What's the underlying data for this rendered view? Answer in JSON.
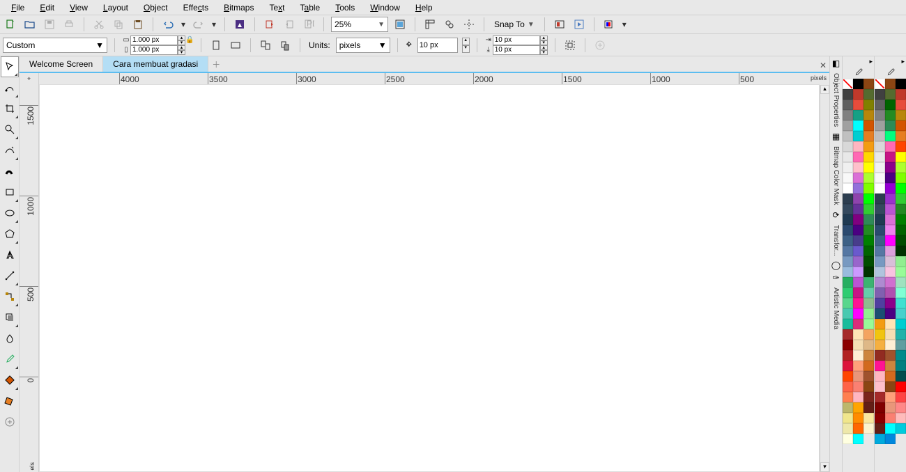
{
  "menu": [
    "File",
    "Edit",
    "View",
    "Layout",
    "Object",
    "Effects",
    "Bitmaps",
    "Text",
    "Table",
    "Tools",
    "Window",
    "Help"
  ],
  "toolbar": {
    "zoom": "25%",
    "snap": "Snap To"
  },
  "propbar": {
    "preset": "Custom",
    "width": "1.000 px",
    "height": "1.000 px",
    "units_label": "Units:",
    "units": "pixels",
    "nudge": "10 px",
    "dup_x": "10 px",
    "dup_y": "10 px"
  },
  "tabs": {
    "welcome": "Welcome Screen",
    "doc": "Cara membuat gradasi"
  },
  "ruler": {
    "hvals": [
      "4000",
      "3500",
      "3000",
      "2500",
      "2000",
      "1500",
      "1000",
      "500"
    ],
    "unit": "pixels",
    "vvals": [
      "1500",
      "1000",
      "500",
      "0"
    ],
    "unitv": "els"
  },
  "dock": {
    "titles": [
      "Object Properties",
      "Bitmap Color Mask",
      "Transfor...",
      "Artistic Media"
    ]
  },
  "palette1": [
    "nocolor",
    "#000000",
    "#8B4513",
    "#404040",
    "#C0392B",
    "#556B2F",
    "#606060",
    "#E74C3C",
    "#808000",
    "#808080",
    "#16A085",
    "#B8860B",
    "#A0A0A0",
    "#00FFFF",
    "#D35400",
    "#C0C0C0",
    "#00CED1",
    "#E67E22",
    "#D8D8D8",
    "#FFB6C1",
    "#F39C12",
    "#E8E8E8",
    "#FF69B4",
    "#FFD700",
    "#F0F0F0",
    "#FFC0CB",
    "#FFFF00",
    "#F8F8F8",
    "#DA70D6",
    "#ADFF2F",
    "#FFFFFF",
    "#9370DB",
    "#7FFF00",
    "#2C3E50",
    "#8E44AD",
    "#00FF00",
    "#34495E",
    "#663399",
    "#32CD32",
    "#1F3A52",
    "#800080",
    "#2E8B57",
    "#2B4A6F",
    "#4B0082",
    "#228B22",
    "#3D6186",
    "#483D8B",
    "#008000",
    "#5577A3",
    "#6A5ACD",
    "#006400",
    "#7799C1",
    "#9966CC",
    "#004d00",
    "#99BBDD",
    "#CC99FF",
    "#003300",
    "#27AE60",
    "#BA55D3",
    "#3CB371",
    "#2ECC71",
    "#C71585",
    "#66CDAA",
    "#58D68D",
    "#FF1493",
    "#8FBC8F",
    "#48C9B0",
    "#FF00FF",
    "#90EE90",
    "#1ABC9C",
    "#DB2E7B",
    "#98FB98",
    "#A52A2A",
    "#FFE4B5",
    "#F4A460",
    "#8B0000",
    "#F5DEB3",
    "#DEB887",
    "#B22222",
    "#FFEFD5",
    "#CD853F",
    "#DC143C",
    "#FFA07A",
    "#D2691E",
    "#FF4500",
    "#E9967A",
    "#A0522D",
    "#FF6347",
    "#FA8072",
    "#8B4513",
    "#FF7F50",
    "#FFB6C1",
    "#7B241C",
    "#BDB76B",
    "#FFA500",
    "#641E16",
    "#F0E68C",
    "#FF8C00",
    "#F9E79F",
    "#EEE8AA",
    "#FF6600",
    "#FCF3CF",
    "#FFFFE0",
    "#00FFFF"
  ],
  "palette2": [
    "nocolor",
    "#8B4513",
    "#000000",
    "#404040",
    "#556B2F",
    "#C0392B",
    "#606060",
    "#006400",
    "#E74C3C",
    "#808080",
    "#228B22",
    "#B8860B",
    "#A0A0A0",
    "#2E8B57",
    "#D35400",
    "#C0C0C0",
    "#00FF7F",
    "#E67E22",
    "#D8D8D8",
    "#FF69B4",
    "#FF4500",
    "#E8E8E8",
    "#C71585",
    "#FFFF00",
    "#F0F0F0",
    "#8B008B",
    "#ADFF2F",
    "#F8F8F8",
    "#4B0082",
    "#7FFF00",
    "#FFFFFF",
    "#9400D3",
    "#00FF00",
    "#2C3E50",
    "#9932CC",
    "#32CD32",
    "#34495E",
    "#BA55D3",
    "#228B22",
    "#1F3A52",
    "#DA70D6",
    "#008000",
    "#2B4A6F",
    "#EE82EE",
    "#006400",
    "#3D6186",
    "#FF00FF",
    "#004d00",
    "#5577A3",
    "#DDA0DD",
    "#003300",
    "#7799C1",
    "#D8BFD8",
    "#90EE90",
    "#B0C4DE",
    "#F8C3E0",
    "#98FB98",
    "#AE8BD1",
    "#D070D0",
    "#9FE2BF",
    "#8060B0",
    "#B050B0",
    "#7FFFD4",
    "#5040A0",
    "#8B008B",
    "#40E0D0",
    "#1B4F72",
    "#4B0082",
    "#48D1CC",
    "#F39C12",
    "#FFE4B5",
    "#00CED1",
    "#F1C40F",
    "#F5DEB3",
    "#20B2AA",
    "#F5B041",
    "#FFEFD5",
    "#5F9EA0",
    "#922B21",
    "#A0522D",
    "#008B8B",
    "#FF1493",
    "#CD853F",
    "#008080",
    "#FFB6C1",
    "#D2691E",
    "#004d4d",
    "#FFC0CB",
    "#8B4513",
    "#FF0000",
    "#A52A2A",
    "#FFA07A",
    "#FF4444",
    "#800000",
    "#E9967A",
    "#FF8888",
    "#8B0000",
    "#FA8072",
    "#FFBBBB",
    "#641E16",
    "#00FFFF",
    "#00CCDD",
    "#00AADD",
    "#0088DD"
  ]
}
